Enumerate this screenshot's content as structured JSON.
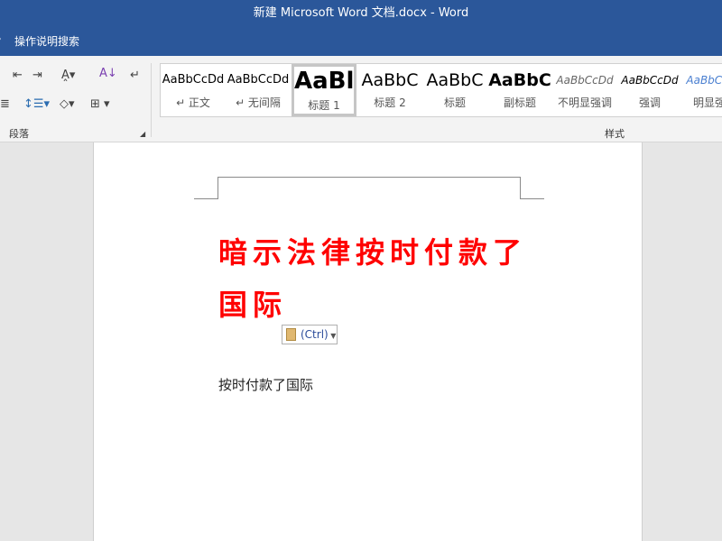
{
  "window": {
    "title": "新建 Microsoft Word 文档.docx  -  Word"
  },
  "tellme": {
    "label": "操作说明搜索"
  },
  "ribbon": {
    "paragraph_group": "段落",
    "styles_group": "样式",
    "styles": [
      {
        "sample": "AaBbCcDd",
        "label": "↵ 正文"
      },
      {
        "sample": "AaBbCcDd",
        "label": "↵ 无间隔"
      },
      {
        "sample": "AaBl",
        "label": "标题 1"
      },
      {
        "sample": "AaBbC",
        "label": "标题 2"
      },
      {
        "sample": "AaBbC",
        "label": "标题"
      },
      {
        "sample": "AaBbC",
        "label": "副标题"
      },
      {
        "sample": "AaBbCcDd",
        "label": "不明显强调"
      },
      {
        "sample": "AaBbCcDd",
        "label": "强调"
      },
      {
        "sample": "AaBbCcDd",
        "label": "明显强调"
      }
    ]
  },
  "document": {
    "heading_line1": "暗示法律按时付款了",
    "heading_line2": "国际",
    "paste_options": "(Ctrl)",
    "body": "按时付款了国际",
    "heading_color": "#ff0000"
  }
}
